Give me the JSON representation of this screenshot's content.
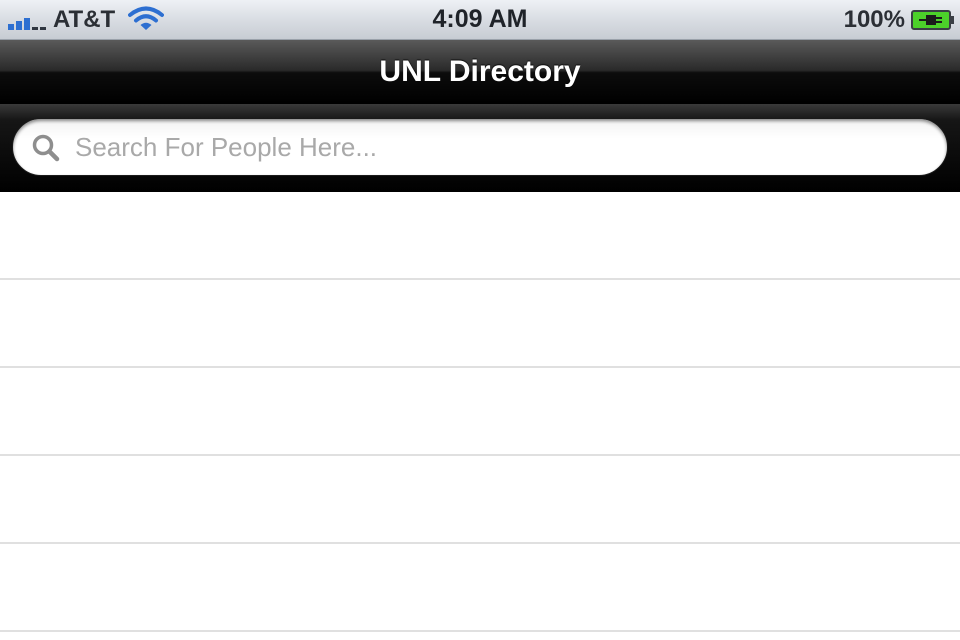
{
  "status_bar": {
    "carrier": "AT&T",
    "time": "4:09 AM",
    "battery_percent": "100%",
    "signal_bars_filled": 3,
    "signal_bars_total": 5,
    "icons": [
      "signal-icon",
      "wifi-icon",
      "battery-charging-icon"
    ],
    "accent_color": "#2d6fd1",
    "battery_color": "#4cd12a"
  },
  "nav_bar": {
    "title": "UNL Directory"
  },
  "search": {
    "placeholder": "Search For People Here...",
    "value": "",
    "icon": "search-icon"
  },
  "table": {
    "rows": [
      "",
      "",
      "",
      "",
      ""
    ]
  }
}
